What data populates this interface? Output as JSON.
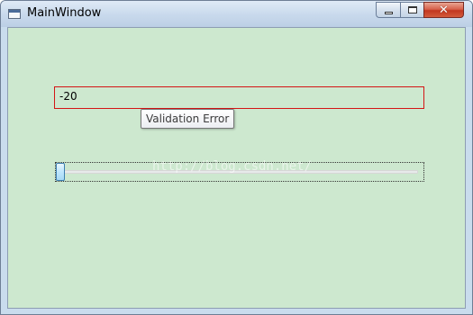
{
  "window": {
    "title": "MainWindow",
    "buttons": {
      "minimize": "minimize",
      "maximize": "maximize",
      "close": "✕"
    }
  },
  "textbox": {
    "value": "-20"
  },
  "tooltip": {
    "text": "Validation Error"
  },
  "slider": {
    "value_fraction": 0.0
  },
  "watermark": {
    "text": "http://blog.csdn.net/"
  },
  "colors": {
    "client_background": "#cde8cf",
    "error_border": "#d41515",
    "title_bar": "#c8d9ec"
  }
}
